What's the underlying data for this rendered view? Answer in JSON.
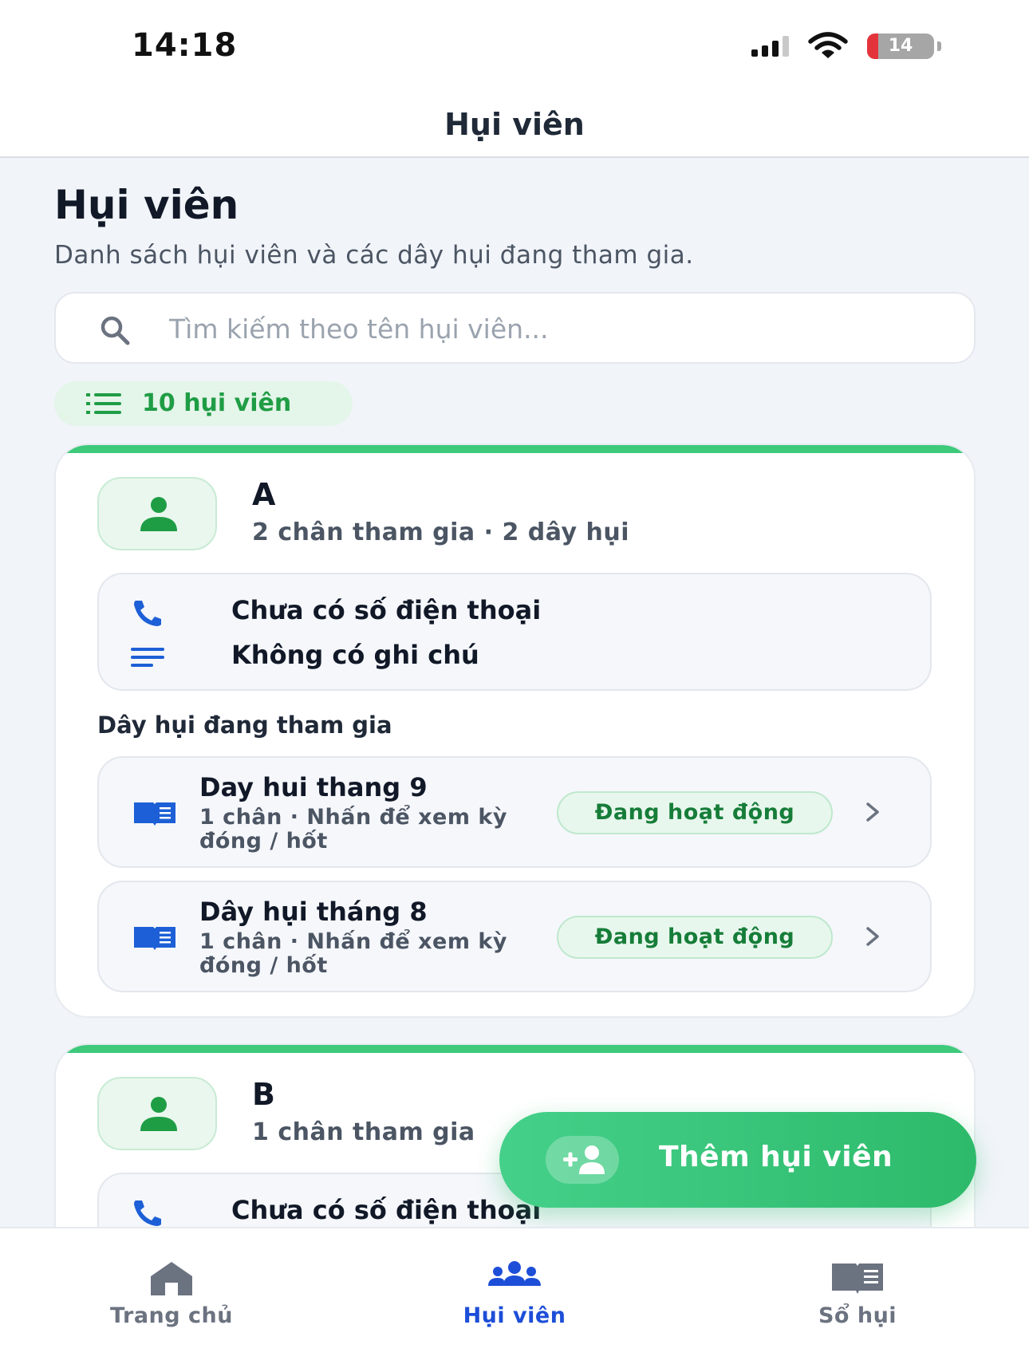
{
  "status_bar": {
    "time": "14:18",
    "battery": "14"
  },
  "nav": {
    "title": "Hụi viên"
  },
  "page": {
    "title": "Hụi viên",
    "subtitle": "Danh sách hụi viên và các dây hụi đang tham gia."
  },
  "search": {
    "placeholder": "Tìm kiếm theo tên hụi viên..."
  },
  "member_count": "10 hụi viên",
  "members": [
    {
      "name": "A",
      "meta": "2 chân tham gia · 2 dây hụi",
      "phone": "Chưa có số điện thoại",
      "note": "Không có ghi chú",
      "section_label": "Dây hụi đang tham gia",
      "groups": [
        {
          "name": "Day hui thang 9",
          "hint": "1 chân · Nhấn để xem kỳ đóng / hốt",
          "status": "Đang hoạt động"
        },
        {
          "name": "Dây hụi tháng 8",
          "hint": "1 chân · Nhấn để xem kỳ đóng / hốt",
          "status": "Đang hoạt động"
        }
      ]
    },
    {
      "name": "B",
      "meta": "1 chân tham gia",
      "phone": "Chưa có số điện thoại"
    }
  ],
  "fab": {
    "label": "Thêm hụi viên"
  },
  "tabs": [
    {
      "label": "Trang chủ",
      "icon": "home-icon"
    },
    {
      "label": "Hụi viên",
      "icon": "members-icon",
      "active": true
    },
    {
      "label": "Sổ hụi",
      "icon": "book-icon"
    }
  ],
  "colors": {
    "accent_green": "#3ec97b",
    "status_green": "#167d39",
    "active_tab_blue": "#1d4ed8",
    "icon_blue": "#1d5fd6"
  }
}
